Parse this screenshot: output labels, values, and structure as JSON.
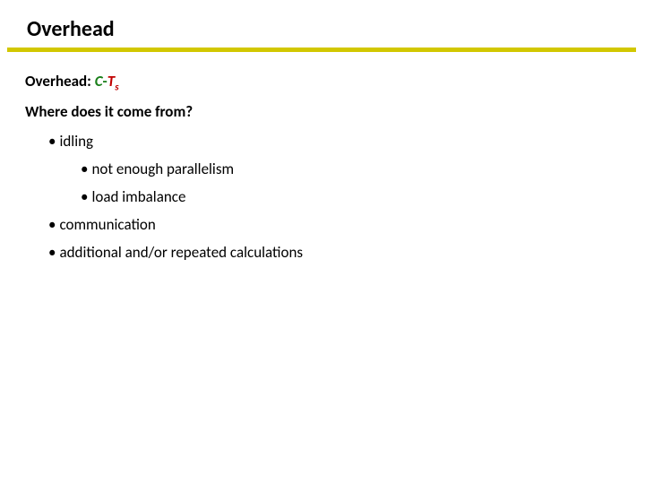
{
  "title": "Overhead",
  "overhead": {
    "label": "Overhead: ",
    "c": "C",
    "dash": "-",
    "t": "T",
    "sub": "s"
  },
  "question": "Where does it come from?",
  "bullets": {
    "b1": "idling",
    "b1a": "not enough parallelism",
    "b1b": "load imbalance",
    "b2": "communication",
    "b3": "additional and/or repeated calculations"
  },
  "dot": "•"
}
